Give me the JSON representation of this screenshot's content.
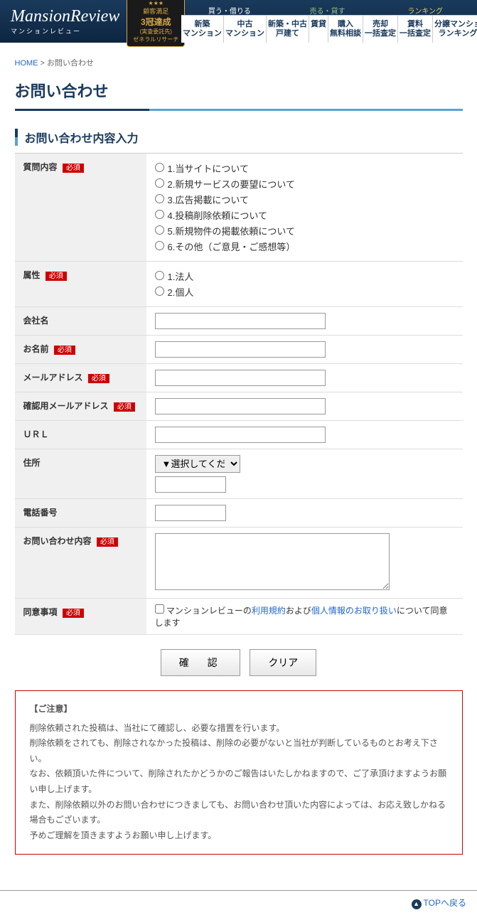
{
  "logo": {
    "main": "MansionReview",
    "sub": "マンションレビュー"
  },
  "badge": {
    "stars": "★★★",
    "line1": "顧客満足",
    "main": "3冠達成",
    "line2": "(実査委託先)",
    "line3": "ゼネラルリサーチ"
  },
  "navTop": {
    "buy": "買う・借りる",
    "sell": "売る・貸す",
    "ranking": "ランキング"
  },
  "navMain": [
    {
      "l1": "新築",
      "l2": "マンション"
    },
    {
      "l1": "中古",
      "l2": "マンション"
    },
    {
      "l1": "新築・中古",
      "l2": "戸建て"
    },
    {
      "l1": "賃貸",
      "l2": ""
    },
    {
      "l1": "購入",
      "l2": "無料相談"
    },
    {
      "l1": "売却",
      "l2": "一括査定"
    },
    {
      "l1": "賃料",
      "l2": "一括査定"
    },
    {
      "l1": "分譲マンショ",
      "l2": "ランキング"
    }
  ],
  "breadcrumb": {
    "home": "HOME",
    "sep": " > ",
    "current": "お問い合わせ"
  },
  "pageTitle": "お問い合わせ",
  "sectionTitle": "お問い合わせ内容入力",
  "required": "必須",
  "labels": {
    "question": "質問内容",
    "attribute": "属性",
    "company": "会社名",
    "name": "お名前",
    "email": "メールアドレス",
    "emailConfirm": "確認用メールアドレス",
    "url": "ＵＲＬ",
    "address": "住所",
    "phone": "電話番号",
    "content": "お問い合わせ内容",
    "consent": "同意事項"
  },
  "questionOptions": [
    "1.当サイトについて",
    "2.新規サービスの要望について",
    "3.広告掲載について",
    "4.投稿削除依頼について",
    "5.新規物件の掲載依頼について",
    "6.その他（ご意見・ご感想等）"
  ],
  "attributeOptions": [
    "1.法人",
    "2.個人"
  ],
  "addressPlaceholder": "▼選択してください▼",
  "consentText": {
    "pre": "マンションレビューの",
    "terms": "利用規約",
    "mid": "および",
    "privacy": "個人情報のお取り扱い",
    "post": "について同意します"
  },
  "buttons": {
    "confirm": "確　認",
    "clear": "クリア"
  },
  "notice": {
    "title": "【ご注意】",
    "lines": [
      "削除依頼された投稿は、当社にて確認し、必要な措置を行います。",
      "削除依頼をされても、削除されなかった投稿は、削除の必要がないと当社が判断しているものとお考え下さい。",
      "なお、依頼頂いた件について、削除されたかどうかのご報告はいたしかねますので、ご了承頂けますようお願い申し上げます。",
      "また、削除依頼以外のお問い合わせにつきましても、お問い合わせ頂いた内容によっては、お応え致しかねる場合もございます。",
      "予めご理解を頂きますようお願い申し上げます。"
    ]
  },
  "pagetop": "TOPへ戻る"
}
